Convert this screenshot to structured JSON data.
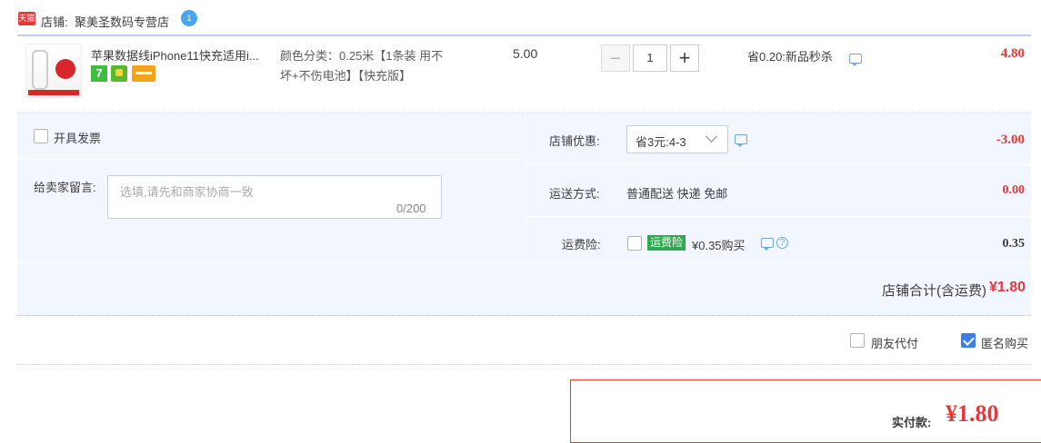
{
  "store": {
    "badge": "天猫",
    "label": "店铺:",
    "name": "聚美圣数码专营店",
    "chat_badge": "1"
  },
  "item": {
    "title": "苹果数据线iPhone11快充适用i...",
    "sku_line1": "颜色分类：0.25米【1条装 用不",
    "sku_line2": "坏+不伤电池】【快充版】",
    "badge_7": "7",
    "unit_price": "5.00",
    "qty_minus": "−",
    "quantity": "1",
    "qty_plus": "+",
    "promo": "省0.20:新品秒杀",
    "subtotal": "4.80"
  },
  "order_options": {
    "invoice_label": "开具发票",
    "invoice_checked": false,
    "message_label": "给卖家留言:",
    "message_placeholder": "选填,请先和商家协商一致",
    "message_count": "0/200"
  },
  "discount": {
    "label": "店铺优惠:",
    "selected": "省3元:4-3",
    "amount": "-3.00"
  },
  "shipping": {
    "label": "运送方式:",
    "method": "普通配送 快递 免邮",
    "amount": "0.00"
  },
  "insurance": {
    "label": "运费险:",
    "badge": "运费险",
    "text": "¥0.35购买",
    "help": "?",
    "amount": "0.35",
    "checked": false
  },
  "store_total": {
    "label": "店铺合计(含运费)",
    "amount": "¥1.80"
  },
  "pay_options": {
    "friend_pay_label": "朋友代付",
    "friend_pay_checked": false,
    "anonymous_label": "匿名购买",
    "anonymous_checked": true
  },
  "payment": {
    "label": "实付款:",
    "amount": "¥1.80"
  },
  "colors": {
    "accent_red": "#e4393c",
    "accent_blue": "#3b7fe6",
    "panel_bg": "#f2f7ff",
    "insurance_green": "#2fa84f"
  }
}
